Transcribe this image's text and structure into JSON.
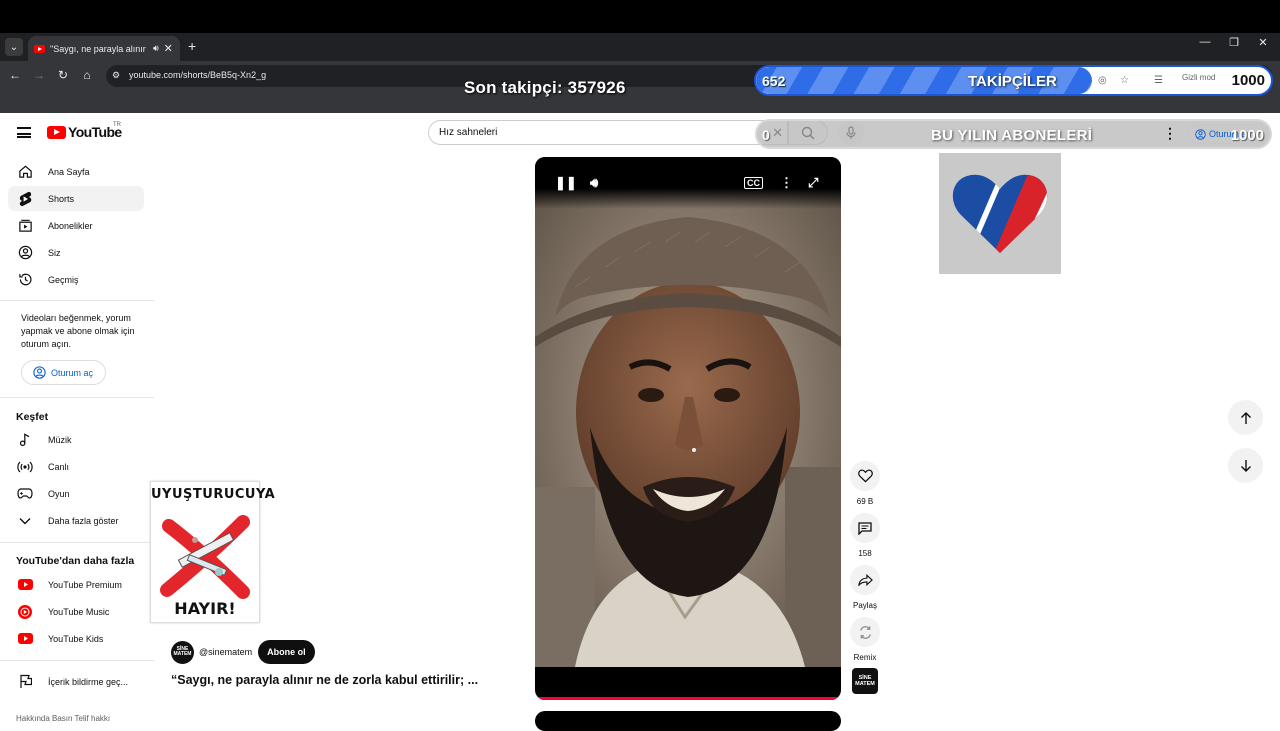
{
  "browser": {
    "tab_title": "\"Saygı, ne parayla alınır ne d",
    "url": "youtube.com/shorts/BeB5q-Xn2_g",
    "new_tab": "+",
    "incognito_label": "Gizli mod"
  },
  "overlay": {
    "last_follower": "Son takipçi: 357926",
    "followers_bar": {
      "current": "652",
      "title": "TAKİPÇİLER",
      "goal": "1000",
      "progress_fraction": 0.652
    },
    "subscribers_bar": {
      "current": "0",
      "title": "BU YILIN ABONELERİ",
      "goal": "1000",
      "progress_fraction": 0.0
    }
  },
  "header": {
    "logo_text": "YouTube",
    "region": "TR",
    "search_value": "Hız sahneleri",
    "signin_label": "Oturum aç"
  },
  "sidebar": {
    "main_items": [
      {
        "label": "Ana Sayfa",
        "icon": "home-icon"
      },
      {
        "label": "Shorts",
        "icon": "shorts-icon"
      },
      {
        "label": "Abonelikler",
        "icon": "subscriptions-icon"
      },
      {
        "label": "Siz",
        "icon": "you-icon"
      },
      {
        "label": "Geçmiş",
        "icon": "history-icon"
      }
    ],
    "signin_prompt": "Videoları beğenmek, yorum yapmak ve abone olmak için oturum açın.",
    "signin_button": "Oturum aç",
    "explore_title": "Keşfet",
    "explore_items": [
      {
        "label": "Müzik",
        "icon": "music-icon"
      },
      {
        "label": "Canlı",
        "icon": "live-icon"
      },
      {
        "label": "Oyun",
        "icon": "gaming-icon"
      },
      {
        "label": "Daha fazla göster",
        "icon": "chevron-down-icon"
      }
    ],
    "more_title": "YouTube'dan daha fazla",
    "more_items": [
      {
        "label": "YouTube Premium",
        "icon": "youtube-premium-icon"
      },
      {
        "label": "YouTube Music",
        "icon": "youtube-music-icon"
      },
      {
        "label": "YouTube Kids",
        "icon": "youtube-kids-icon"
      }
    ],
    "report_item": {
      "label": "İçerik bildirme geç...",
      "icon": "flag-icon"
    },
    "footer": "Hakkında  Basın  Telif hakkı"
  },
  "sticker": {
    "top_text": "UYUŞTURUCUYA",
    "bottom_text": "HAYIR!"
  },
  "short": {
    "channel_handle": "@sinematem",
    "channel_avatar_text": "SİNE MATEM",
    "subscribe_label": "Abone ol",
    "title": "“Saygı, ne parayla alınır ne de zorla kabul ettirilir; ...",
    "progress_fraction": 1.0
  },
  "actions": {
    "likes": "69 B",
    "comments": "158",
    "share": "Paylaş",
    "remix": "Remix"
  }
}
